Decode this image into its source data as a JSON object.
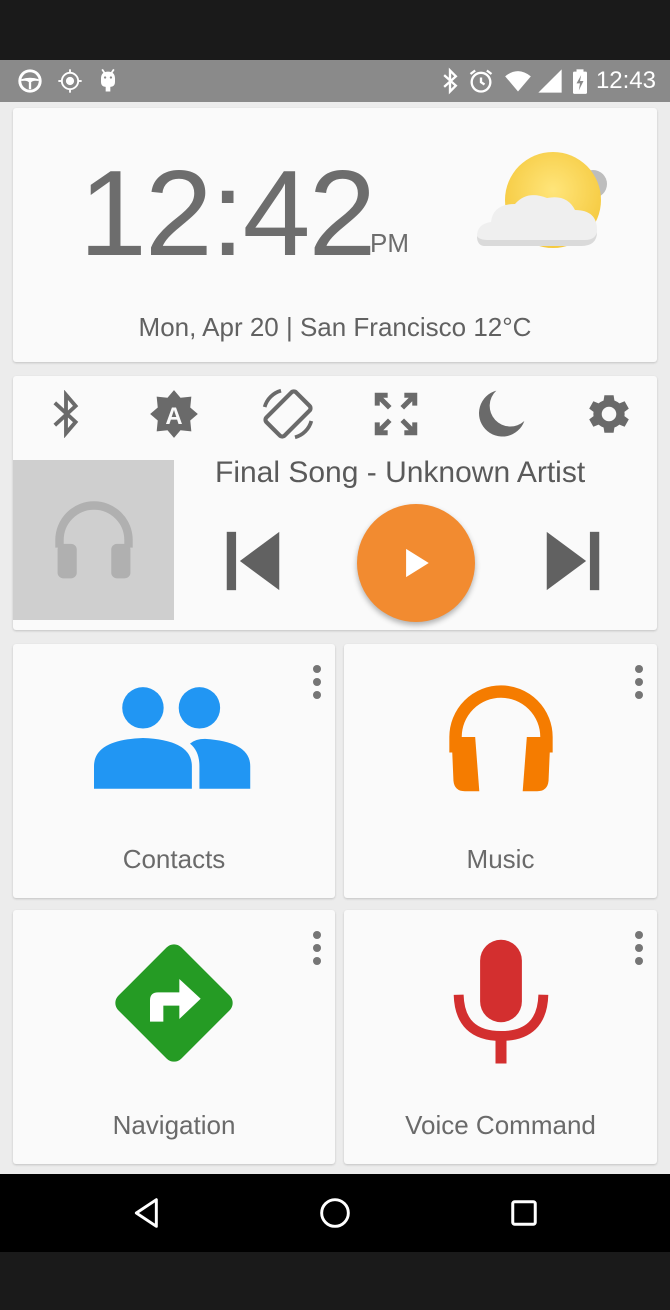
{
  "status_bar": {
    "time": "12:43",
    "left_icons": [
      "steering-wheel-icon",
      "location-icon",
      "android-debug-icon"
    ],
    "right_icons": [
      "bluetooth-icon",
      "alarm-icon",
      "wifi-icon",
      "signal-icon",
      "battery-charging-icon"
    ]
  },
  "clock": {
    "time": "12:42",
    "ampm": "PM",
    "date_line": "Mon, Apr 20 | San Francisco 12°C",
    "weather_icon": "partly-cloudy-icon"
  },
  "quick_settings": {
    "icons": [
      "bluetooth-icon",
      "auto-brightness-icon",
      "screen-rotation-icon",
      "fullscreen-icon",
      "night-mode-icon",
      "settings-icon"
    ]
  },
  "media": {
    "song_title": "Final Song - Unknown Artist",
    "album_art_icon": "headphones-icon",
    "accent_color": "#f28b30"
  },
  "tiles": [
    {
      "label": "Contacts",
      "icon": "contacts-icon",
      "color": "#2196f3"
    },
    {
      "label": "Music",
      "icon": "headphones-icon",
      "color": "#f57c00"
    },
    {
      "label": "Navigation",
      "icon": "navigation-icon",
      "color": "#259b24"
    },
    {
      "label": "Voice Command",
      "icon": "microphone-icon",
      "color": "#d32f2f"
    }
  ],
  "nav_bar": {
    "buttons": [
      "back-icon",
      "home-icon",
      "recents-icon"
    ]
  }
}
